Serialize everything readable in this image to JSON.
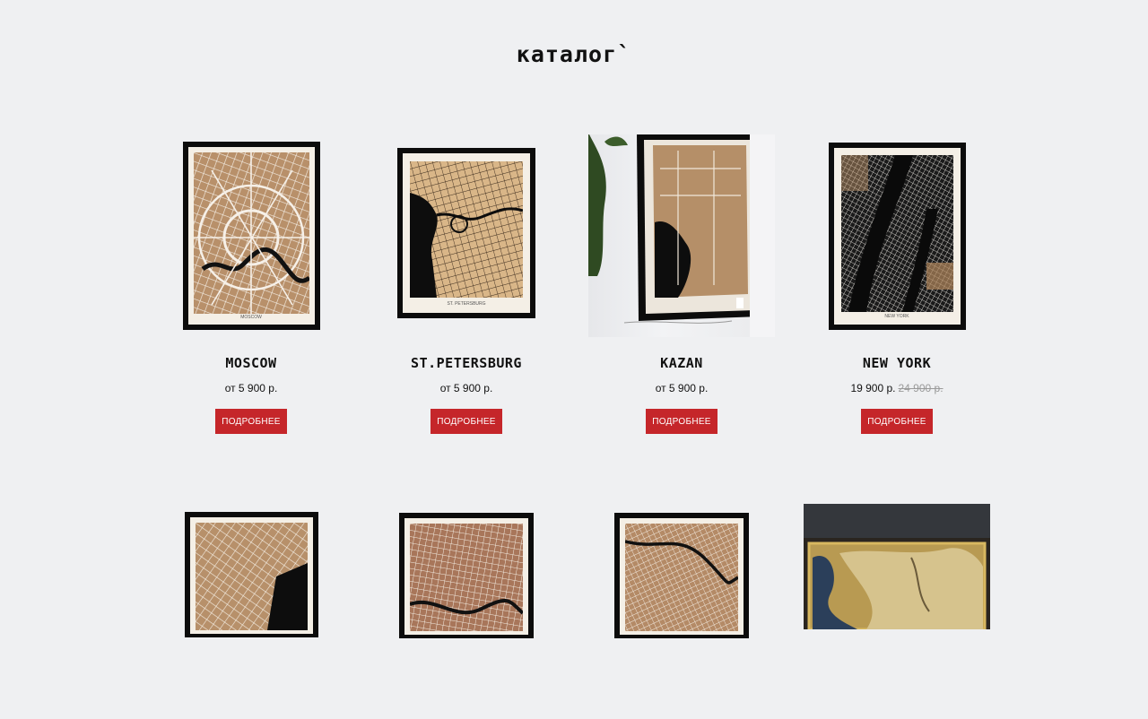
{
  "page": {
    "title": "каталог`"
  },
  "products": [
    {
      "name": "MOSCOW",
      "price": "от 5 900 р.",
      "button": "ПОДРОБНЕЕ",
      "map_caption": "MOSCOW"
    },
    {
      "name": "ST.PETERSBURG",
      "price": "от 5 900 р.",
      "button": "ПОДРОБНЕЕ",
      "map_caption": "ST. PETERSBURG"
    },
    {
      "name": "KAZAN",
      "price": "от 5 900 р.",
      "button": "ПОДРОБНЕЕ"
    },
    {
      "name": "NEW YORK",
      "price": "19 900 р.",
      "old_price": "24 900 р.",
      "button": "ПОДРОБНЕЕ",
      "map_caption": "NEW YORK"
    }
  ],
  "colors": {
    "button": "#c5262a",
    "background": "#eff0f2",
    "frame": "#0c0c0c",
    "wood": "#c8a27a"
  }
}
